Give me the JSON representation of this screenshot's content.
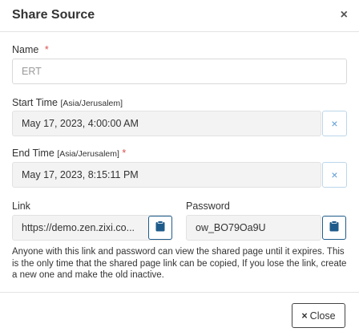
{
  "dialog": {
    "title": "Share Source",
    "close_icon": "×"
  },
  "name": {
    "label": "Name",
    "required_mark": "*",
    "placeholder": "ERT"
  },
  "start_time": {
    "label": "Start Time",
    "timezone": "[Asia/Jerusalem]",
    "value": "May 17, 2023, 4:00:00 AM",
    "clear_icon": "×"
  },
  "end_time": {
    "label": "End Time",
    "timezone": "[Asia/Jerusalem]",
    "required_mark": "*",
    "value": "May 17, 2023, 8:15:11 PM",
    "clear_icon": "×"
  },
  "link": {
    "label": "Link",
    "value": "https://demo.zen.zixi.co...",
    "copy_icon": "clipboard-icon"
  },
  "password": {
    "label": "Password",
    "value": "ow_BO79Oa9U",
    "copy_icon": "clipboard-icon"
  },
  "note": "Anyone with this link and password can view the shared page until it expires. This is the only time that the shared page link can be copied, If you lose the link, create a new one and make the old inactive.",
  "footer": {
    "close_icon": "×",
    "close_label": "Close"
  },
  "colors": {
    "required": "#d9534f",
    "clear_icon": "#5b9bd5",
    "copy_icon": "#1f5c8b"
  }
}
